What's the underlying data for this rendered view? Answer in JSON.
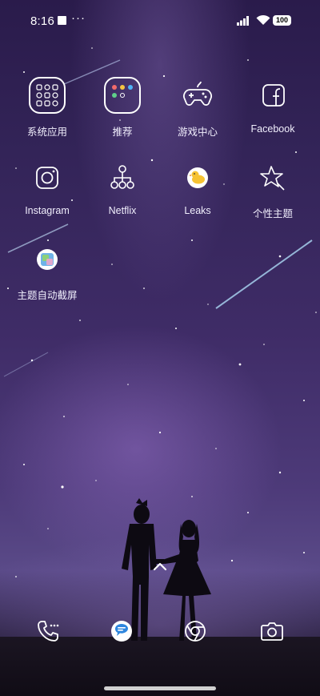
{
  "status_bar": {
    "time": "8:16",
    "more": "···",
    "battery": "100"
  },
  "apps": [
    {
      "label": "系统应用",
      "icon": "app-folder-icon"
    },
    {
      "label": "推荐",
      "icon": "recommend-folder-icon"
    },
    {
      "label": "游戏中心",
      "icon": "gamepad-icon"
    },
    {
      "label": "Facebook",
      "icon": "facebook-icon"
    },
    {
      "label": "Instagram",
      "icon": "instagram-icon"
    },
    {
      "label": "Netflix",
      "icon": "network-nodes-icon"
    },
    {
      "label": "Leaks",
      "icon": "duck-icon"
    },
    {
      "label": "个性主题",
      "icon": "theme-star-icon"
    },
    {
      "label": "主题自动截屏",
      "icon": "screenshot-icon"
    }
  ],
  "dock": [
    {
      "icon": "phone-icon"
    },
    {
      "icon": "messages-icon"
    },
    {
      "icon": "chrome-icon"
    },
    {
      "icon": "camera-icon"
    }
  ],
  "colors": {
    "accent_blue": "#2e86de",
    "background_top": "#2a1b4b",
    "background_bottom": "#0e0b16"
  }
}
